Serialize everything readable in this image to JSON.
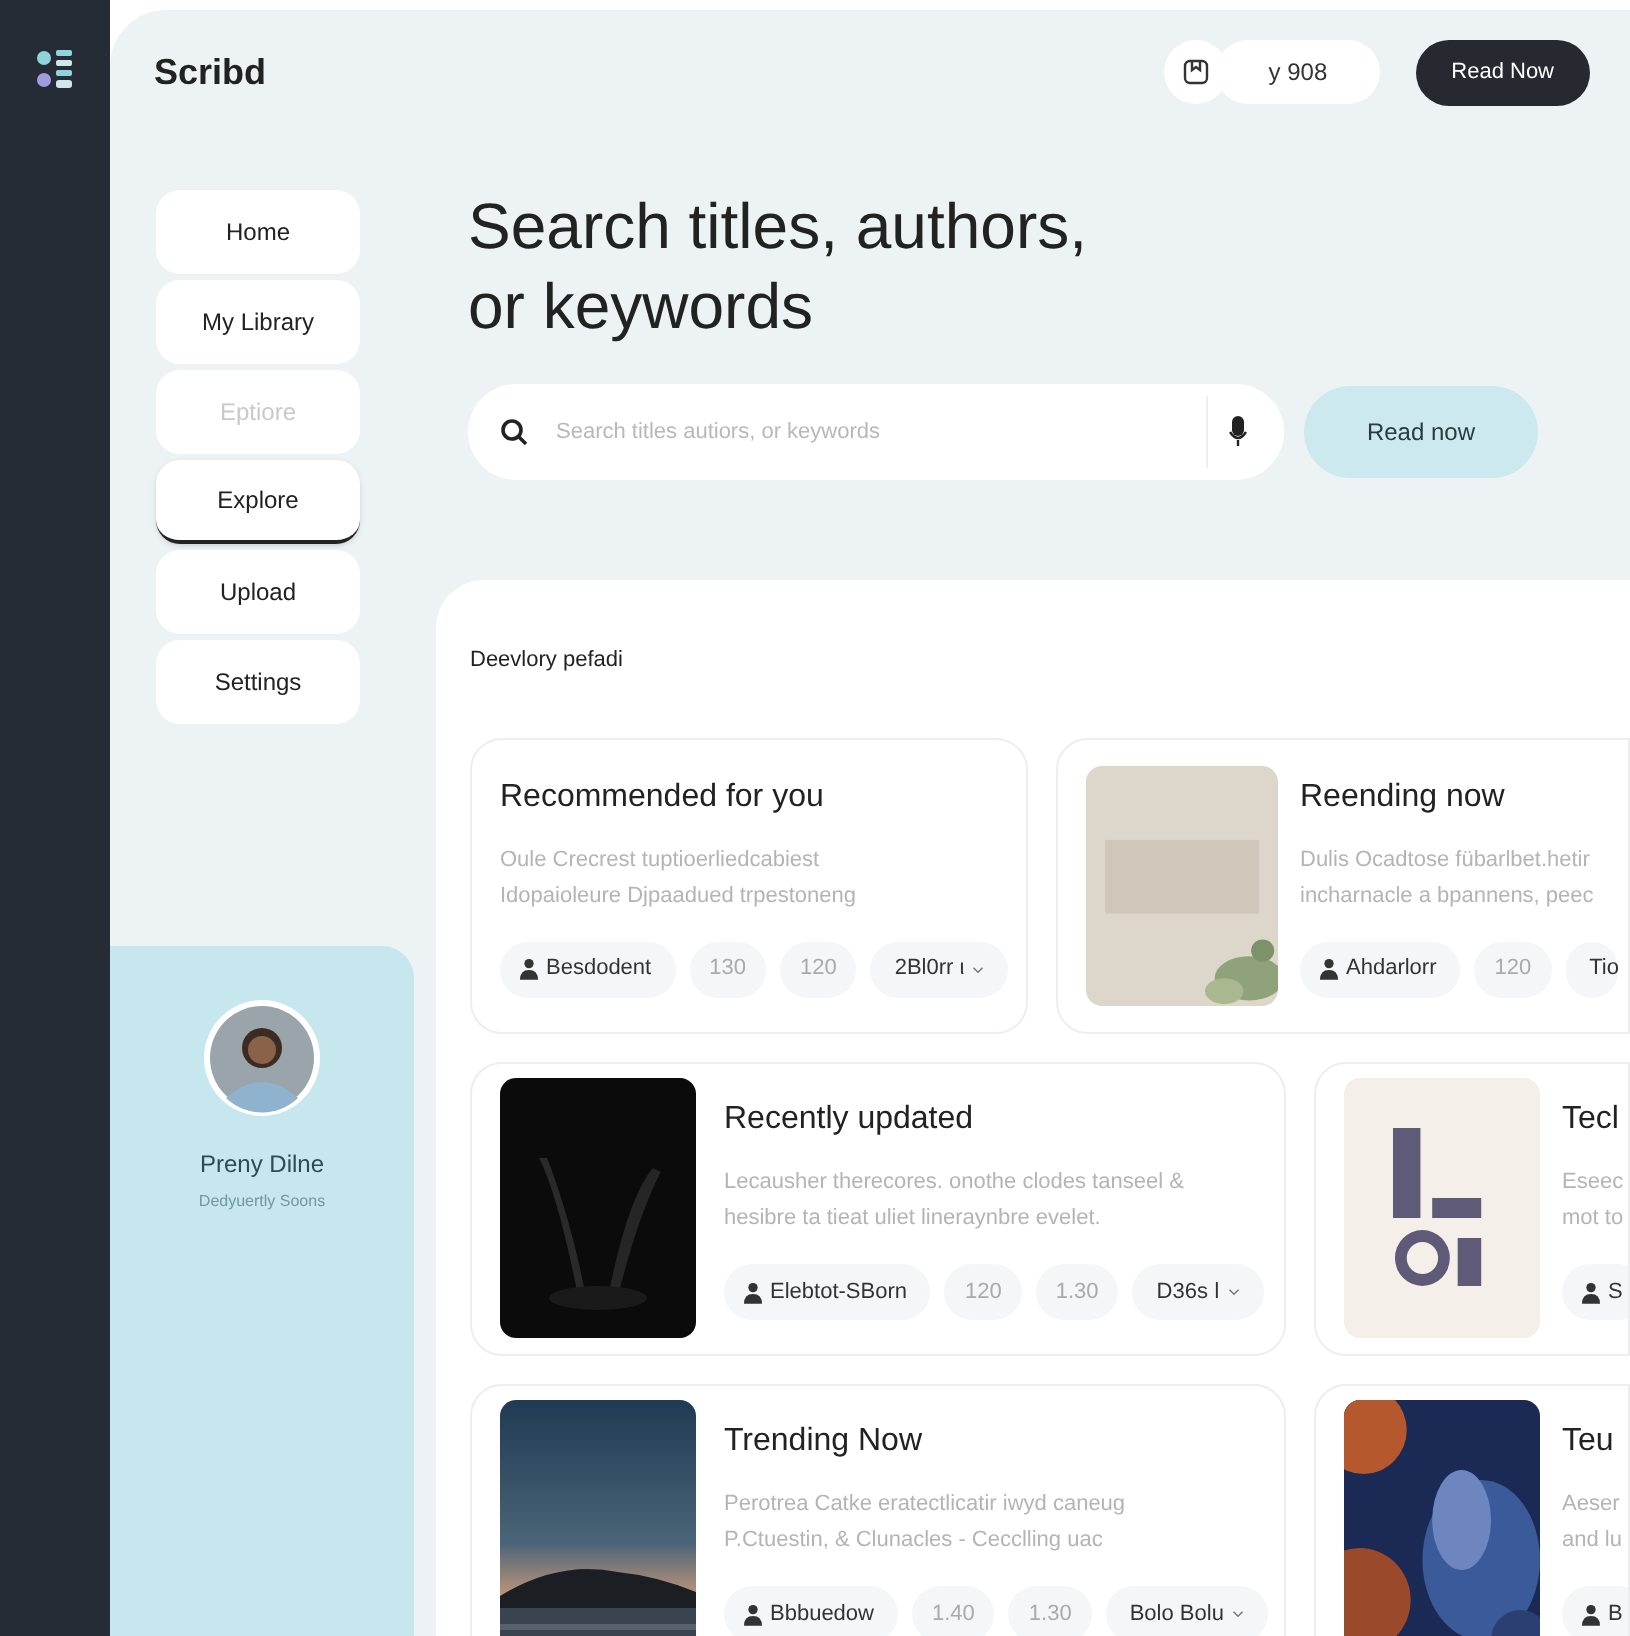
{
  "brand": "Scribd",
  "header": {
    "pill": "y 908",
    "button": "Read Now"
  },
  "nav": [
    {
      "label": "Home",
      "selected": false,
      "disabled": false
    },
    {
      "label": "My Library",
      "selected": false,
      "disabled": false
    },
    {
      "label": "Eptiore",
      "selected": false,
      "disabled": true
    },
    {
      "label": "Explore",
      "selected": true,
      "disabled": false
    },
    {
      "label": "Upload",
      "selected": false,
      "disabled": false
    },
    {
      "label": "Settings",
      "selected": false,
      "disabled": false
    }
  ],
  "profile": {
    "name": "Preny Dilne",
    "subtitle": "Dedyuertly Soons"
  },
  "heading": "Search titles, authors, or keywords",
  "search": {
    "placeholder": "Search titles autiors, or keywords",
    "button": "Read now"
  },
  "panel_title": "Deevlory pefadi",
  "rows": [
    {
      "cards": [
        {
          "title": "Recommended for you",
          "lines": [
            "Oule Crecrest tuptioerliedcabiest",
            "Idopaioleure Djpaadued trpestoneng"
          ],
          "chips": [
            {
              "kind": "person",
              "text": "Besdodent"
            },
            {
              "kind": "count",
              "text": "130"
            },
            {
              "kind": "count",
              "text": "120"
            },
            {
              "kind": "dropdown",
              "text": "2Bl0rr ι"
            }
          ]
        },
        {
          "title": "Reending now",
          "lines": [
            "Dulis Ocadtose fübarlbet.hetir",
            "incharnacle a bpannens, peec"
          ],
          "cover": {
            "kind": "picture"
          },
          "chips": [
            {
              "kind": "person",
              "text": "Ahdarlorr"
            },
            {
              "kind": "count",
              "text": "120"
            },
            {
              "kind": "plain",
              "text": "Tio"
            }
          ]
        }
      ]
    },
    {
      "cards": [
        {
          "title": "Recently updated",
          "lines": [
            "Lecausher therecores. onothe clodes tanseel &",
            "hesibre ta tieat uliet lineraynbre evelet."
          ],
          "cover": {
            "kind": "picture"
          },
          "chips": [
            {
              "kind": "person",
              "text": "Elebtot-SBorn"
            },
            {
              "kind": "count",
              "text": "120"
            },
            {
              "kind": "count",
              "text": "1.30"
            },
            {
              "kind": "dropdown",
              "text": "D36s ǀ"
            }
          ]
        },
        {
          "title": "Tecl",
          "lines": [
            "Eseec",
            "mot to"
          ],
          "cover": {
            "kind": "picture"
          },
          "chips": [
            {
              "kind": "person",
              "text": "S"
            }
          ]
        }
      ]
    },
    {
      "cards": [
        {
          "title": "Trending Now",
          "lines": [
            "Perotrea Catke eratectlicatir iwyd caneug",
            "P.Ctuestin, & Clunacles - Cecclling uac"
          ],
          "cover": {
            "kind": "picture"
          },
          "chips": [
            {
              "kind": "person",
              "text": "Bbbuedow"
            },
            {
              "kind": "count",
              "text": "1.40"
            },
            {
              "kind": "count",
              "text": "1.30"
            },
            {
              "kind": "dropdown",
              "text": "Bolo Bolu"
            }
          ]
        },
        {
          "title": "Teu",
          "lines": [
            "Aeser",
            "and lu"
          ],
          "cover": {
            "kind": "picture"
          },
          "chips": [
            {
              "kind": "person",
              "text": "B"
            }
          ]
        }
      ]
    }
  ]
}
